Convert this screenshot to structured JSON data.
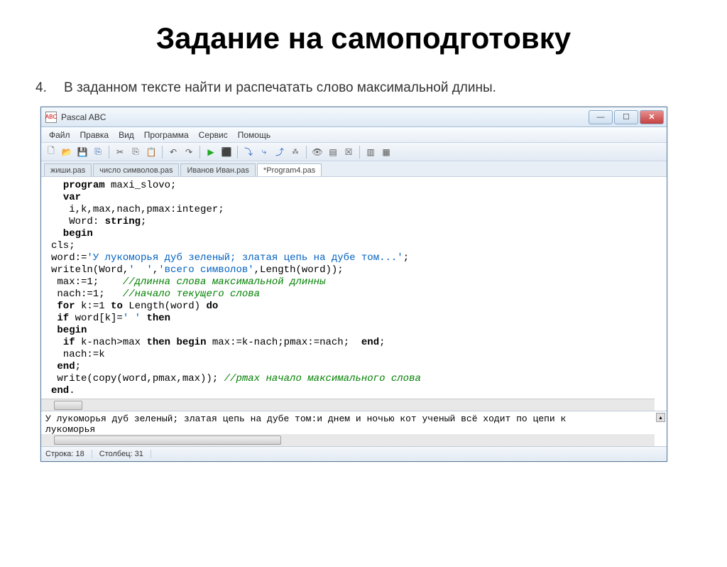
{
  "slide": {
    "title": "Задание на самоподготовку",
    "task_num": "4.",
    "task_text": "В заданном тексте найти и распечатать слово максимальной длины."
  },
  "window": {
    "title": "Pascal ABC",
    "icon_text": "ABC"
  },
  "menu": {
    "file": "Файл",
    "edit": "Правка",
    "view": "Вид",
    "program": "Программа",
    "service": "Сервис",
    "help": "Помощь"
  },
  "tabs": {
    "t1": "жиши.pas",
    "t2": "число символов.pas",
    "t3": "Иванов Иван.pas",
    "t4": "*Program4.pas"
  },
  "code": {
    "l1_kw": "program",
    "l1_rest": " maxi_slovo;",
    "l2_kw": "var",
    "l3": " i,k,max,nach,pmax:integer;",
    "l4_a": " Word: ",
    "l4_kw": "string",
    "l4_b": ";",
    "l5_kw": " begin",
    "l6": "cls;",
    "l7_a": "word:=",
    "l7_str": "'У лукоморья дуб зеленый; златая цепь на дубе том...'",
    "l7_b": ";",
    "l8_a": "writeln(Word,",
    "l8_str1": "'  '",
    "l8_b": ",",
    "l8_str2": "'всего символов'",
    "l8_c": ",Length(word));",
    "l9_a": " max:=1;    ",
    "l9_cmt": "//длинна слова максимальной длинны",
    "l10_a": " nach:=1;   ",
    "l10_cmt": "//начало текущего слова",
    "l11_a": " ",
    "l11_kw1": "for",
    "l11_b": " k:=1 ",
    "l11_kw2": "to",
    "l11_c": " Length(word) ",
    "l11_kw3": "do",
    "l12_a": " ",
    "l12_kw": "if",
    "l12_b": " word[k]=",
    "l12_str": "' '",
    "l12_c": " ",
    "l12_kw2": "then",
    "l13_kw": " begin",
    "l14_a": "  ",
    "l14_kw1": "if",
    "l14_b": " k-nach>max ",
    "l14_kw2": "then begin",
    "l14_c": " max:=k-nach;pmax:=nach;  ",
    "l14_kw3": "end",
    "l14_d": ";",
    "l15": "  nach:=k",
    "l16_kw": " end",
    "l16_b": ";",
    "l17_a": " write(copy(word,pmax,max)); ",
    "l17_cmt": "//pmax начало максимального слова",
    "l18_kw": "end",
    "l18_b": "."
  },
  "output": {
    "text": "У лукоморья дуб зеленый; златая цепь на дубе том:и днем и ночью кот ученый всё ходит по цепи к",
    "line2": "лукоморья"
  },
  "status": {
    "line": "Строка: 18",
    "col": "Столбец: 31"
  }
}
